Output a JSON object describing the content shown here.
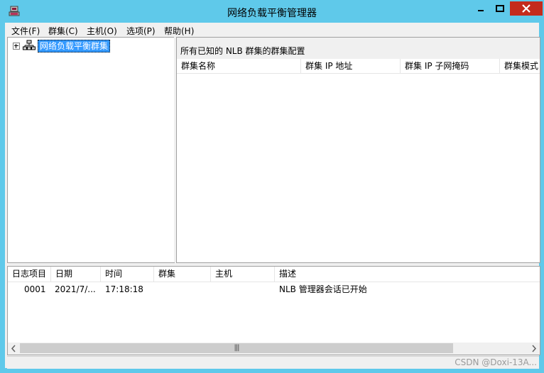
{
  "window": {
    "title": "网络负载平衡管理器",
    "close_color": "#c42b1c",
    "frame_color": "#5fc9ea"
  },
  "menu": {
    "items": [
      "文件(F)",
      "群集(C)",
      "主机(O)",
      "选项(P)",
      "帮助(H)"
    ]
  },
  "tree": {
    "root_label": "网络负载平衡群集",
    "root_icon": "network-cluster-icon"
  },
  "cluster_panel": {
    "caption": "所有已知的 NLB 群集的群集配置",
    "columns": [
      "群集名称",
      "群集 IP 地址",
      "群集 IP 子网掩码",
      "群集模式"
    ]
  },
  "log": {
    "columns": [
      "日志项目",
      "日期",
      "时间",
      "群集",
      "主机",
      "描述"
    ],
    "rows": [
      {
        "entry": "0001",
        "date": "2021/7/...",
        "time": "17:18:18",
        "cluster": "",
        "host": "",
        "description": "NLB 管理器会话已开始"
      }
    ]
  },
  "watermark": "CSDN @Doxi-13A..."
}
